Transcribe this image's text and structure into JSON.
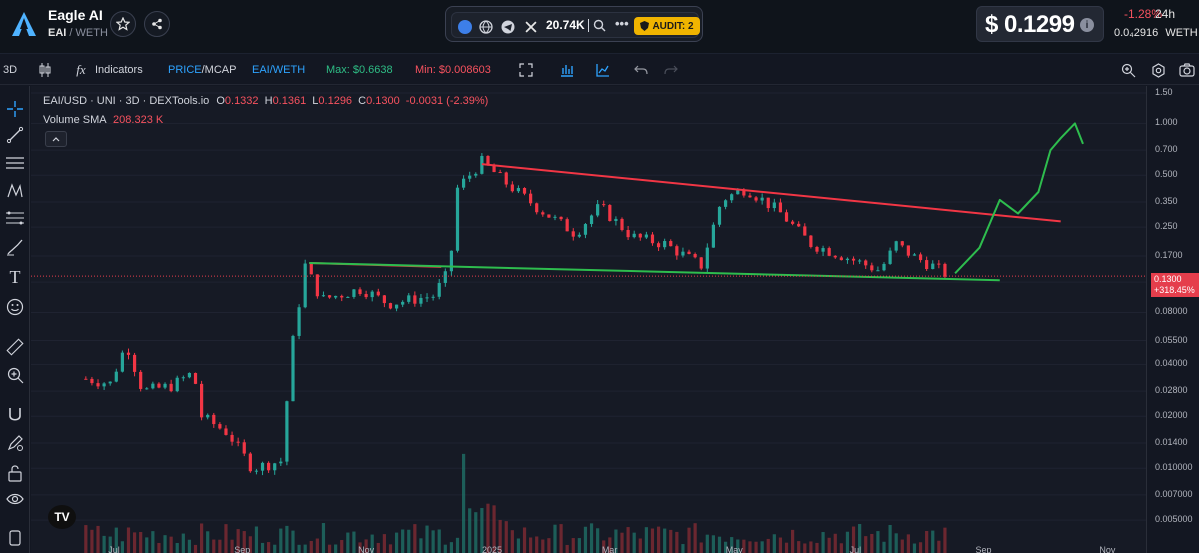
{
  "header": {
    "token_name": "Eagle AI",
    "token_symbol": "EAI",
    "pair_quote": "/ WETH",
    "followers": "20.74K",
    "audit_label": "AUDIT: 2",
    "price": "$ 0.1299",
    "info_glyph": "i",
    "change_pct": "-1.28%",
    "change_period": "24h",
    "eth_price": "0.0₄2916",
    "eth_label": "WETH",
    "icons": [
      "eagle-logo",
      "star-icon",
      "share-icon",
      "ethereum-icon",
      "globe-icon",
      "telegram-icon",
      "x-icon",
      "search-icon",
      "more-icon",
      "shield-icon",
      "info-icon"
    ]
  },
  "toolbar": {
    "timeframe": "3D",
    "indicators_label": "Indicators",
    "price_label": "PRICE",
    "mcap_label": "/MCAP",
    "pair_label": "EAI/WETH",
    "max_label": "Max: $0.6638",
    "min_label": "Min: $0.008603",
    "colors": {
      "price": "#2ea3ff",
      "pair": "#2ea3ff",
      "max": "#2ebd85",
      "min": "#f7525f"
    }
  },
  "legend": {
    "symbol": "EAI/USD · UNI · 3D · DEXTools.io",
    "o_label": "O",
    "o": "0.1332",
    "h_label": "H",
    "h": "0.1361",
    "l_label": "L",
    "l": "0.1296",
    "c_label": "C",
    "c": "0.1300",
    "change": "-0.0031 (-2.39%)",
    "volume_label": "Volume SMA",
    "volume_value": "208.323 K"
  },
  "axis": {
    "y_ticks": [
      "1.50",
      "1.000",
      "0.700",
      "0.500",
      "0.350",
      "0.250",
      "0.1700",
      "0.1200",
      "0.08000",
      "0.05500",
      "0.04000",
      "0.02800",
      "0.02000",
      "0.01400",
      "0.010000",
      "0.007000",
      "0.005000"
    ],
    "x_ticks": [
      "Jul",
      "Sep",
      "Nov",
      "2025",
      "Mar",
      "May",
      "Jul",
      "Sep",
      "Nov"
    ],
    "last_price": "0.1300",
    "last_change": "+318.45%",
    "tv_logo": "TV"
  },
  "chart_data": {
    "type": "candlestick",
    "title": "EAI/USD · UNI · 3D · DEXTools.io",
    "y_scale": "log",
    "ylim": [
      0.0045,
      1.5
    ],
    "x_range": [
      "2024-05-20",
      "2025-11-20"
    ],
    "colors": {
      "up": "#26a69a",
      "down": "#f23645",
      "trend_resistance": "#f23645",
      "trend_support": "#2ebd4e",
      "projection": "#2ebd4e"
    },
    "ohlc_close_path": [
      {
        "date": "2024-06-16",
        "close": 0.033
      },
      {
        "date": "2024-06-28",
        "close": 0.031
      },
      {
        "date": "2024-07-06",
        "close": 0.053
      },
      {
        "date": "2024-07-14",
        "close": 0.028
      },
      {
        "date": "2024-07-28",
        "close": 0.03
      },
      {
        "date": "2024-08-08",
        "close": 0.036
      },
      {
        "date": "2024-08-12",
        "close": 0.02
      },
      {
        "date": "2024-08-25",
        "close": 0.016
      },
      {
        "date": "2024-09-06",
        "close": 0.01
      },
      {
        "date": "2024-09-20",
        "close": 0.011
      },
      {
        "date": "2024-09-26",
        "close": 0.055
      },
      {
        "date": "2024-10-02",
        "close": 0.15
      },
      {
        "date": "2024-10-10",
        "close": 0.095
      },
      {
        "date": "2024-10-30",
        "close": 0.11
      },
      {
        "date": "2024-11-12",
        "close": 0.09
      },
      {
        "date": "2024-12-04",
        "close": 0.1
      },
      {
        "date": "2024-12-12",
        "close": 0.14
      },
      {
        "date": "2024-12-16",
        "close": 0.42
      },
      {
        "date": "2024-12-28",
        "close": 0.6
      },
      {
        "date": "2025-01-09",
        "close": 0.45
      },
      {
        "date": "2025-01-25",
        "close": 0.32
      },
      {
        "date": "2025-02-12",
        "close": 0.23
      },
      {
        "date": "2025-02-24",
        "close": 0.33
      },
      {
        "date": "2025-03-12",
        "close": 0.22
      },
      {
        "date": "2025-03-28",
        "close": 0.2
      },
      {
        "date": "2025-04-15",
        "close": 0.15
      },
      {
        "date": "2025-04-25",
        "close": 0.36
      },
      {
        "date": "2025-05-07",
        "close": 0.42
      },
      {
        "date": "2025-05-23",
        "close": 0.31
      },
      {
        "date": "2025-06-08",
        "close": 0.2
      },
      {
        "date": "2025-06-24",
        "close": 0.17
      },
      {
        "date": "2025-07-12",
        "close": 0.14
      },
      {
        "date": "2025-07-20",
        "close": 0.2
      },
      {
        "date": "2025-07-28",
        "close": 0.17
      },
      {
        "date": "2025-08-09",
        "close": 0.145
      },
      {
        "date": "2025-08-15",
        "close": 0.13
      }
    ],
    "trendlines": [
      {
        "name": "resistance-upper",
        "color": "#f23645",
        "points": [
          [
            "2024-12-28",
            0.58
          ],
          [
            "2025-10-09",
            0.27
          ]
        ]
      },
      {
        "name": "resistance-lower",
        "color": "#f23645",
        "points": [
          [
            "2024-10-04",
            0.155
          ],
          [
            "2024-12-08",
            0.147
          ]
        ]
      },
      {
        "name": "support",
        "color": "#2ebd4e",
        "points": [
          [
            "2024-10-04",
            0.155
          ],
          [
            "2025-09-09",
            0.123
          ]
        ]
      }
    ],
    "projection": [
      {
        "date": "2025-08-18",
        "value": 0.135
      },
      {
        "date": "2025-08-30",
        "value": 0.19
      },
      {
        "date": "2025-09-09",
        "value": 0.36
      },
      {
        "date": "2025-09-18",
        "value": 0.3
      },
      {
        "date": "2025-09-28",
        "value": 0.4
      },
      {
        "date": "2025-10-04",
        "value": 0.7
      },
      {
        "date": "2025-10-09",
        "value": 0.82
      },
      {
        "date": "2025-10-16",
        "value": 1.0
      },
      {
        "date": "2025-10-20",
        "value": 0.76
      }
    ]
  }
}
